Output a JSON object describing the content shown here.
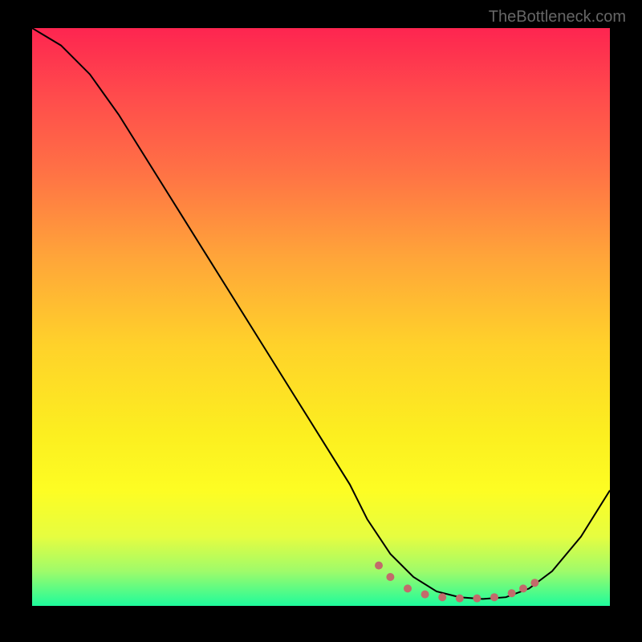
{
  "watermark": "TheBottleneck.com",
  "chart_data": {
    "type": "line",
    "title": "",
    "xlabel": "",
    "ylabel": "",
    "xlim": [
      0,
      100
    ],
    "ylim": [
      0,
      100
    ],
    "series": [
      {
        "name": "curve",
        "x": [
          0,
          5,
          10,
          15,
          20,
          25,
          30,
          35,
          40,
          45,
          50,
          55,
          58,
          62,
          66,
          70,
          74,
          78,
          82,
          86,
          90,
          95,
          100
        ],
        "y": [
          100,
          97,
          92,
          85,
          77,
          69,
          61,
          53,
          45,
          37,
          29,
          21,
          15,
          9,
          5,
          2.5,
          1.5,
          1.2,
          1.5,
          3,
          6,
          12,
          20
        ]
      }
    ],
    "markers": {
      "name": "dotted-points",
      "color": "#c26b6b",
      "x": [
        60,
        62,
        65,
        68,
        71,
        74,
        77,
        80,
        83,
        85,
        87
      ],
      "y": [
        7,
        5,
        3,
        2,
        1.5,
        1.3,
        1.3,
        1.5,
        2.2,
        3,
        4
      ]
    },
    "gradient_colors": {
      "top": "#fe2550",
      "middle": "#ffd22a",
      "bottom": "#1efb9c"
    }
  }
}
